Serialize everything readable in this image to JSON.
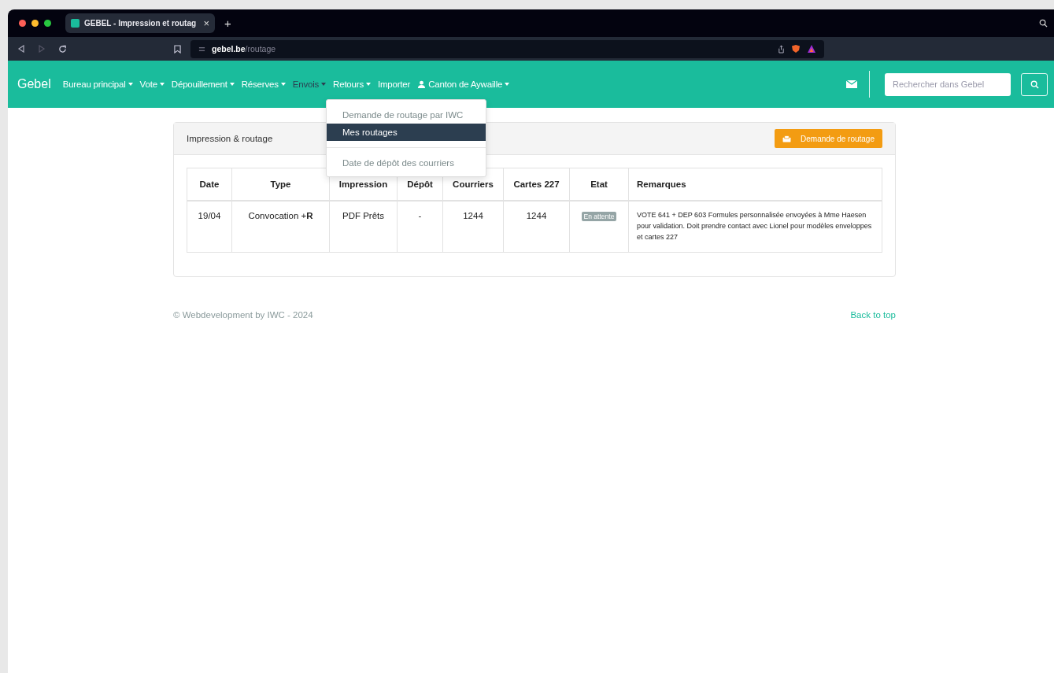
{
  "browser": {
    "tab_title": "GEBEL - Impression et routag",
    "tab_close": "×",
    "new_tab": "+",
    "url_host": "gebel.be",
    "url_path": "/routage"
  },
  "navbar": {
    "brand": "Gebel",
    "items": [
      {
        "label": "Bureau principal",
        "kind": "menu",
        "selected": false
      },
      {
        "label": "Vote",
        "kind": "menu",
        "selected": false
      },
      {
        "label": "Dépouillement",
        "kind": "menu",
        "selected": false
      },
      {
        "label": "Réserves",
        "kind": "menu",
        "selected": false
      },
      {
        "label": "Envois",
        "kind": "menu",
        "selected": true
      },
      {
        "label": "Retours",
        "kind": "menu",
        "selected": false
      },
      {
        "label": "Importer",
        "kind": "link",
        "selected": false
      },
      {
        "label": "Canton de Aywaille",
        "kind": "user",
        "selected": false
      }
    ],
    "search": {
      "placeholder": "Rechercher dans Gebel"
    }
  },
  "dropdown": {
    "sections": [
      [
        {
          "label": "Demande de routage par IWC",
          "selected": false
        },
        {
          "label": "Mes routages",
          "selected": true
        }
      ],
      [
        {
          "label": "Date de dépôt des courriers",
          "selected": false
        }
      ]
    ]
  },
  "panel": {
    "title": "Impression & routage",
    "button": "Demande de routage",
    "table": {
      "columns": [
        "Date",
        "Type",
        "Impression",
        "Dépôt",
        "Courriers",
        "Cartes 227",
        "Etat",
        "Remarques"
      ],
      "rows": [
        {
          "date": "19/04",
          "type": "Convocation +**R**",
          "impression": "PDF Prêts",
          "depot": "-",
          "courriers": "1244",
          "cartes": "1244",
          "etat": "En attente",
          "remarques": "VOTE 641 + DEP 603 Formules personnalisée envoyées à Mme Haesen pour validation. Doit prendre contact avec Lionel pour modèles enveloppes et cartes 227"
        }
      ]
    }
  },
  "footer": {
    "copyright": "© Webdevelopment by IWC - 2024",
    "back_to_top": "Back to top"
  }
}
